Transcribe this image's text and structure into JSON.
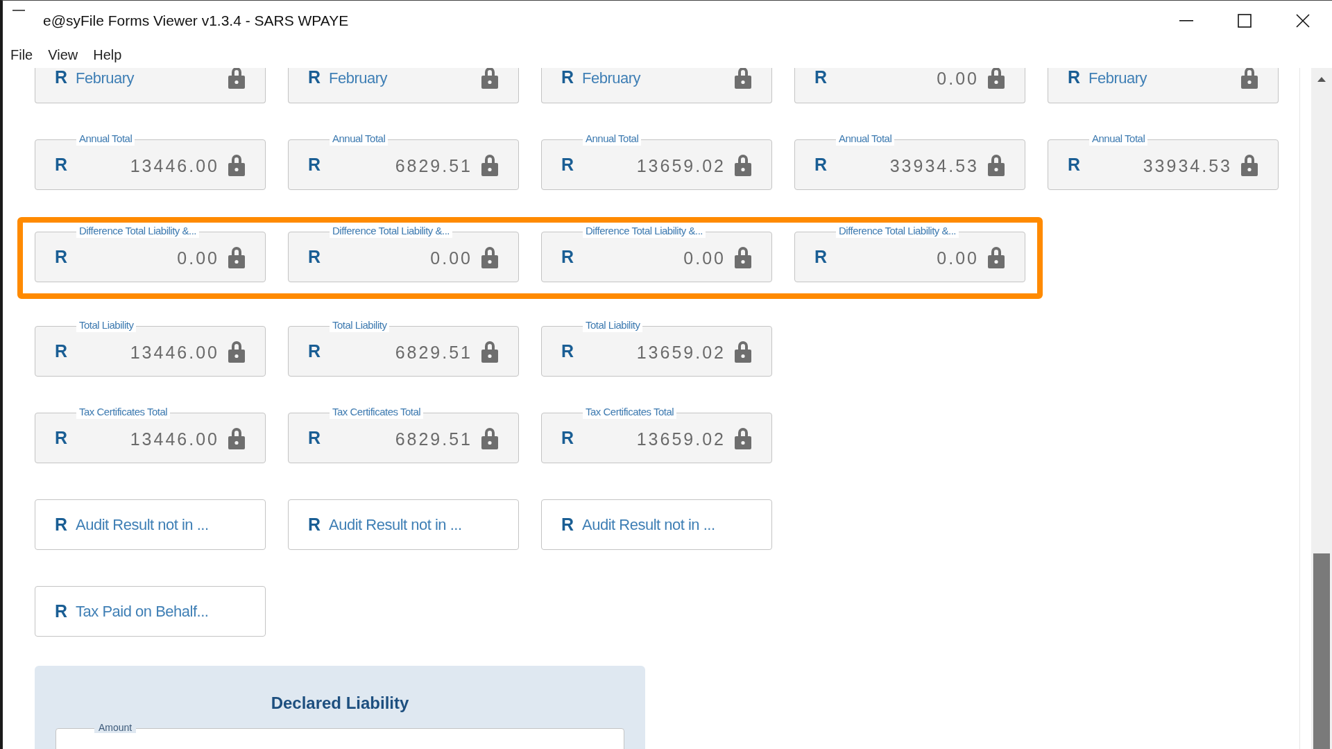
{
  "window": {
    "title": "e@syFile Forms Viewer v1.3.4 - SARS WPAYE"
  },
  "menu": [
    "File",
    "View",
    "Help"
  ],
  "rows": [
    {
      "highlighted": false,
      "fields": [
        {
          "kind": "text",
          "prefix": "R",
          "value": "February",
          "locked": true
        },
        {
          "kind": "text",
          "prefix": "R",
          "value": "February",
          "locked": true
        },
        {
          "kind": "text",
          "prefix": "R",
          "value": "February",
          "locked": true
        },
        {
          "kind": "amount",
          "prefix": "R",
          "value": "0.00",
          "locked": true
        },
        {
          "kind": "text",
          "prefix": "R",
          "value": "February",
          "locked": true
        }
      ]
    },
    {
      "highlighted": false,
      "fields": [
        {
          "kind": "amount",
          "label": "Annual Total",
          "prefix": "R",
          "value": "13446.00",
          "locked": true
        },
        {
          "kind": "amount",
          "label": "Annual Total",
          "prefix": "R",
          "value": "6829.51",
          "locked": true
        },
        {
          "kind": "amount",
          "label": "Annual Total",
          "prefix": "R",
          "value": "13659.02",
          "locked": true
        },
        {
          "kind": "amount",
          "label": "Annual Total",
          "prefix": "R",
          "value": "33934.53",
          "locked": true
        },
        {
          "kind": "amount",
          "label": "Annual Total",
          "prefix": "R",
          "value": "33934.53",
          "locked": true
        }
      ]
    },
    {
      "highlighted": true,
      "fields": [
        {
          "kind": "amount",
          "label": "Difference Total Liability &...",
          "prefix": "R",
          "value": "0.00",
          "locked": true
        },
        {
          "kind": "amount",
          "label": "Difference Total Liability &...",
          "prefix": "R",
          "value": "0.00",
          "locked": true
        },
        {
          "kind": "amount",
          "label": "Difference Total Liability &...",
          "prefix": "R",
          "value": "0.00",
          "locked": true
        },
        {
          "kind": "amount",
          "label": "Difference Total Liability &...",
          "prefix": "R",
          "value": "0.00",
          "locked": true
        }
      ]
    },
    {
      "highlighted": false,
      "fields": [
        {
          "kind": "amount",
          "label": "Total Liability",
          "prefix": "R",
          "value": "13446.00",
          "locked": true
        },
        {
          "kind": "amount",
          "label": "Total Liability",
          "prefix": "R",
          "value": "6829.51",
          "locked": true
        },
        {
          "kind": "amount",
          "label": "Total Liability",
          "prefix": "R",
          "value": "13659.02",
          "locked": true
        }
      ]
    },
    {
      "highlighted": false,
      "fields": [
        {
          "kind": "amount",
          "label": "Tax Certificates Total",
          "prefix": "R",
          "value": "13446.00",
          "locked": true
        },
        {
          "kind": "amount",
          "label": "Tax Certificates Total",
          "prefix": "R",
          "value": "6829.51",
          "locked": true
        },
        {
          "kind": "amount",
          "label": "Tax Certificates Total",
          "prefix": "R",
          "value": "13659.02",
          "locked": true
        }
      ]
    },
    {
      "highlighted": false,
      "fields": [
        {
          "kind": "text",
          "prefix": "R",
          "value": "Audit Result not in ...",
          "locked": false
        },
        {
          "kind": "text",
          "prefix": "R",
          "value": "Audit Result not in ...",
          "locked": false
        },
        {
          "kind": "text",
          "prefix": "R",
          "value": "Audit Result not in ...",
          "locked": false
        }
      ]
    },
    {
      "highlighted": false,
      "fields": [
        {
          "kind": "text",
          "prefix": "R",
          "value": "Tax Paid on Behalf...",
          "locked": false
        }
      ]
    }
  ],
  "declared_panel": {
    "title": "Declared Liability",
    "field_label": "Amount"
  }
}
